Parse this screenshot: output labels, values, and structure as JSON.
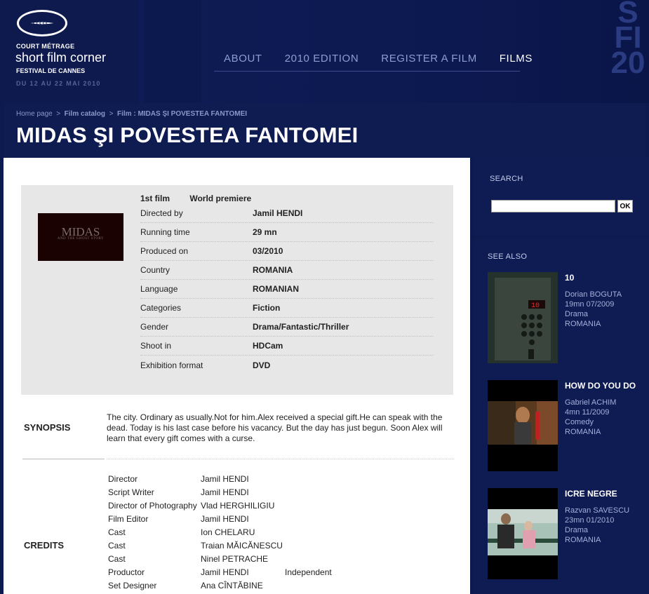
{
  "logo": {
    "line1": "COURT MÉTRAGE",
    "line2": "short film corner",
    "line3": "FESTIVAL DE CANNES",
    "dates": "DU 12 AU 22 MAI 2010"
  },
  "nav": [
    {
      "label": "ABOUT"
    },
    {
      "label": "2010 EDITION"
    },
    {
      "label": "REGISTER A FILM"
    },
    {
      "label": "FILMS"
    }
  ],
  "breadcrumb": {
    "home": "Home page",
    "sep": ">",
    "catalog": "Film catalog",
    "current": "Film : MIDAS ŞI POVESTEA FANTOMEI"
  },
  "page_title": "MIDAS ŞI POVESTEA FANTOMEI",
  "poster": {
    "title": "MIDAS",
    "subtitle": "AND THE GHOST STORY"
  },
  "flags": [
    "1st film",
    "World premiere"
  ],
  "info": [
    {
      "label": "Directed by",
      "value": "Jamil HENDI"
    },
    {
      "label": "Running time",
      "value": "29 mn"
    },
    {
      "label": "Produced on",
      "value": "03/2010"
    },
    {
      "label": "Country",
      "value": "ROMANIA"
    },
    {
      "label": "Language",
      "value": "ROMANIAN"
    },
    {
      "label": "Categories",
      "value": "Fiction"
    },
    {
      "label": "Gender",
      "value": "Drama/Fantastic/Thriller"
    },
    {
      "label": "Shoot in",
      "value": "HDCam"
    },
    {
      "label": "Exhibition format",
      "value": "DVD"
    }
  ],
  "synopsis": {
    "title": "SYNOPSIS",
    "text": "The city. Ordinary as usually.Not for him.Alex received a special gift.He can speak with the dead. Today is his last case before his vacancy. But the day has just begun. Soon Alex will learn that every gift comes with a curse."
  },
  "credits": {
    "title": "CREDITS",
    "rows": [
      {
        "role": "Director",
        "name": "Jamil HENDI",
        "extra": ""
      },
      {
        "role": "Script Writer",
        "name": "Jamil HENDI",
        "extra": ""
      },
      {
        "role": "Director of Photography",
        "name": "Vlad HERGHILIGIU",
        "extra": ""
      },
      {
        "role": "Film Editor",
        "name": "Jamil HENDI",
        "extra": ""
      },
      {
        "role": "Cast",
        "name": "Ion CHELARU",
        "extra": ""
      },
      {
        "role": "Cast",
        "name": "Traian MĂICĂNESCU",
        "extra": ""
      },
      {
        "role": "Cast",
        "name": "Ninel PETRACHE",
        "extra": ""
      },
      {
        "role": "Productor",
        "name": "Jamil HENDI",
        "extra": "Independent"
      },
      {
        "role": "Set Designer",
        "name": "Ana CÎNTĂBINE",
        "extra": ""
      }
    ]
  },
  "sidebar": {
    "search_title": "SEARCH",
    "search_value": "",
    "ok_label": "OK",
    "see_also_title": "SEE ALSO",
    "see_also": [
      {
        "title": "10",
        "author": "Dorian BOGUTA",
        "duration": "19mn 07/2009",
        "genre": "Drama",
        "country": "ROMANIA",
        "overlay": "10"
      },
      {
        "title": "HOW DO YOU DO",
        "author": "Gabriel ACHIM",
        "duration": "4mn 11/2009",
        "genre": "Comedy",
        "country": "ROMANIA",
        "overlay": ""
      },
      {
        "title": "ICRE NEGRE",
        "author": "Razvan SAVESCU",
        "duration": "23mn 01/2010",
        "genre": "Drama",
        "country": "ROMANIA",
        "overlay": ""
      }
    ]
  }
}
